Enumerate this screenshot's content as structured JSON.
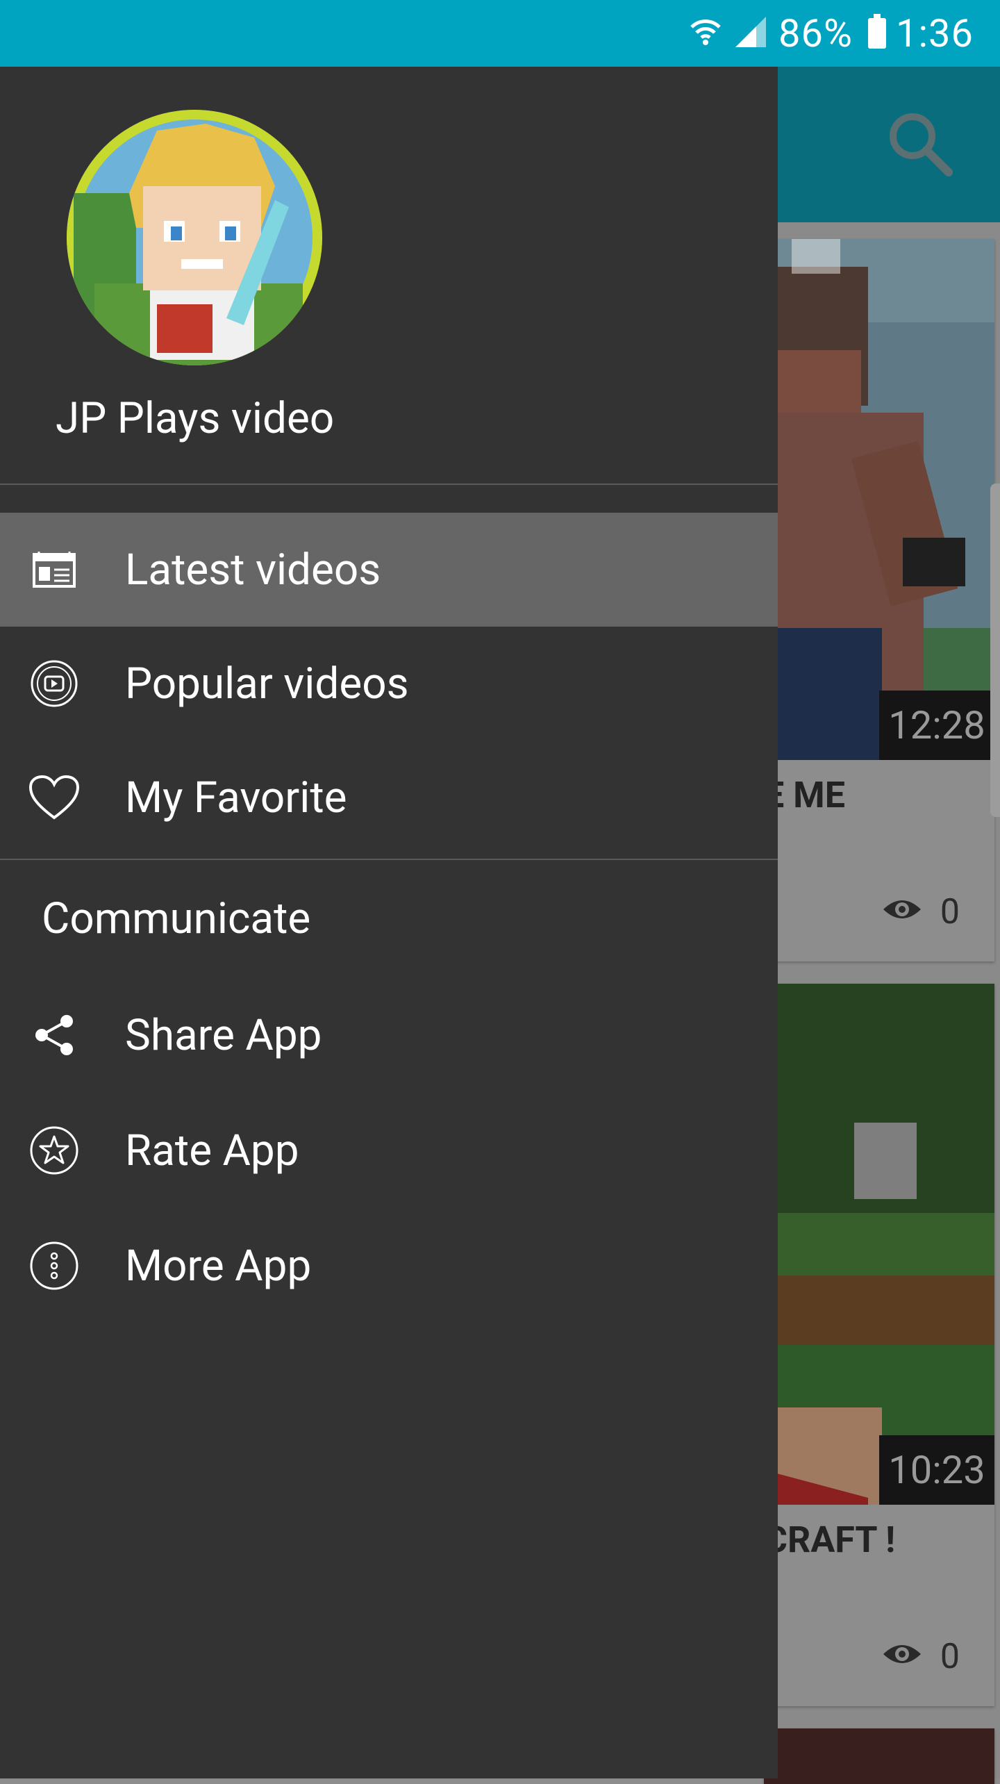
{
  "status_bar": {
    "battery": "86%",
    "time": "1:36",
    "icons": [
      "wifi-icon",
      "signal-icon",
      "battery-icon"
    ]
  },
  "drawer": {
    "app_name": "JP Plays video",
    "items": [
      {
        "label": "Latest videos",
        "icon": "calendar-icon",
        "selected": true
      },
      {
        "label": "Popular videos",
        "icon": "play-circle-icon",
        "selected": false
      },
      {
        "label": "My Favorite",
        "icon": "heart-icon",
        "selected": false
      }
    ],
    "section_title": "Communicate",
    "communicate_items": [
      {
        "label": "Share App",
        "icon": "share-icon"
      },
      {
        "label": "Rate App",
        "icon": "star-circle-icon"
      },
      {
        "label": "More App",
        "icon": "more-dots-icon"
      }
    ]
  },
  "background_feed": {
    "search_icon": "search-icon",
    "cards": [
      {
        "duration": "12:28",
        "title_fragment": "E ME",
        "views": "0"
      },
      {
        "duration": "10:23",
        "title_fragment": "CRAFT !",
        "views": "0"
      }
    ]
  },
  "colors": {
    "status_bar": "#00a4c0",
    "drawer_bg": "#333333",
    "selected_item": "#666666"
  }
}
